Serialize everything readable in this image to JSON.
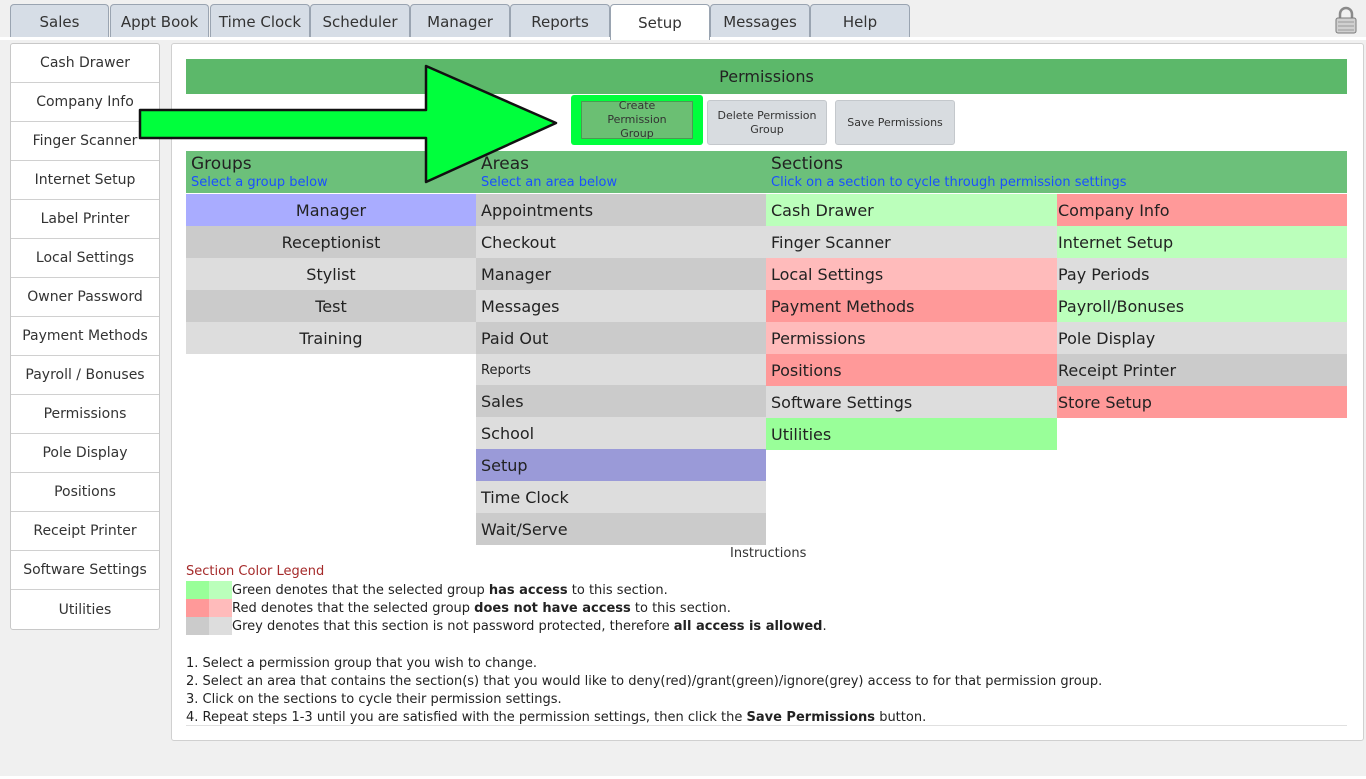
{
  "tabs": [
    "Sales",
    "Appt Book",
    "Time Clock",
    "Scheduler",
    "Manager",
    "Reports",
    "Setup",
    "Messages",
    "Help"
  ],
  "active_tab": "Setup",
  "sidebar": [
    "Cash Drawer",
    "Company Info",
    "Finger Scanner",
    "Internet Setup",
    "Label Printer",
    "Local Settings",
    "Owner Password",
    "Payment Methods",
    "Payroll / Bonuses",
    "Permissions",
    "Pole Display",
    "Positions",
    "Receipt Printer",
    "Software Settings",
    "Utilities"
  ],
  "header": {
    "title": "Permissions"
  },
  "buttons": {
    "create": "Create Permission Group",
    "delete": "Delete Permission Group",
    "save": "Save Permissions"
  },
  "columns": {
    "groups": {
      "title": "Groups",
      "hint": "Select a group below"
    },
    "areas": {
      "title": "Areas",
      "hint": "Select an area below"
    },
    "sections": {
      "title": "Sections",
      "hint": "Click on a section to cycle through permission settings"
    }
  },
  "groups": [
    "Manager",
    "Receptionist",
    "Stylist",
    "Test",
    "Training"
  ],
  "areas": [
    "Appointments",
    "Checkout",
    "Manager",
    "Messages",
    "Paid Out",
    "Reports",
    "Sales",
    "School",
    "Setup",
    "Time Clock",
    "Wait/Serve"
  ],
  "sections_left": [
    "Cash Drawer",
    "Finger Scanner",
    "Local Settings",
    "Payment Methods",
    "Permissions",
    "Positions",
    "Software Settings",
    "Utilities"
  ],
  "sections_right": [
    "Company Info",
    "Internet Setup",
    "Pay Periods",
    "Payroll/Bonuses",
    "Pole Display",
    "Receipt Printer",
    "Store Setup"
  ],
  "instructions_title": "Instructions",
  "legend": {
    "title": "Section Color Legend",
    "green": {
      "pre": "Green denotes that the selected group ",
      "bold": "has access",
      "post": " to this section."
    },
    "red": {
      "pre": "Red denotes that the selected group ",
      "bold": "does not have access",
      "post": " to this section."
    },
    "grey": {
      "pre": "Grey denotes that this section is not password protected, therefore ",
      "bold": "all access is allowed",
      "post": "."
    }
  },
  "steps": {
    "s1": "1. Select a permission group that you wish to change.",
    "s2": "2. Select an area that contains the section(s) that you would like to deny(red)/grant(green)/ignore(grey) access to for that permission group.",
    "s3": "3. Click on the sections to cycle their permission settings.",
    "s4_pre": "4. Repeat steps 1-3 until you are satisfied with the permission settings, then click the ",
    "s4_bold": "Save Permissions",
    "s4_post": " button."
  },
  "colors": {
    "header_green": "#5cb86a",
    "highlight_green": "#00ff3c",
    "selected_group": "#a9acff",
    "selected_area": "#9a9ad8",
    "access_green": "#99ff99",
    "deny_red": "#ff9999"
  }
}
